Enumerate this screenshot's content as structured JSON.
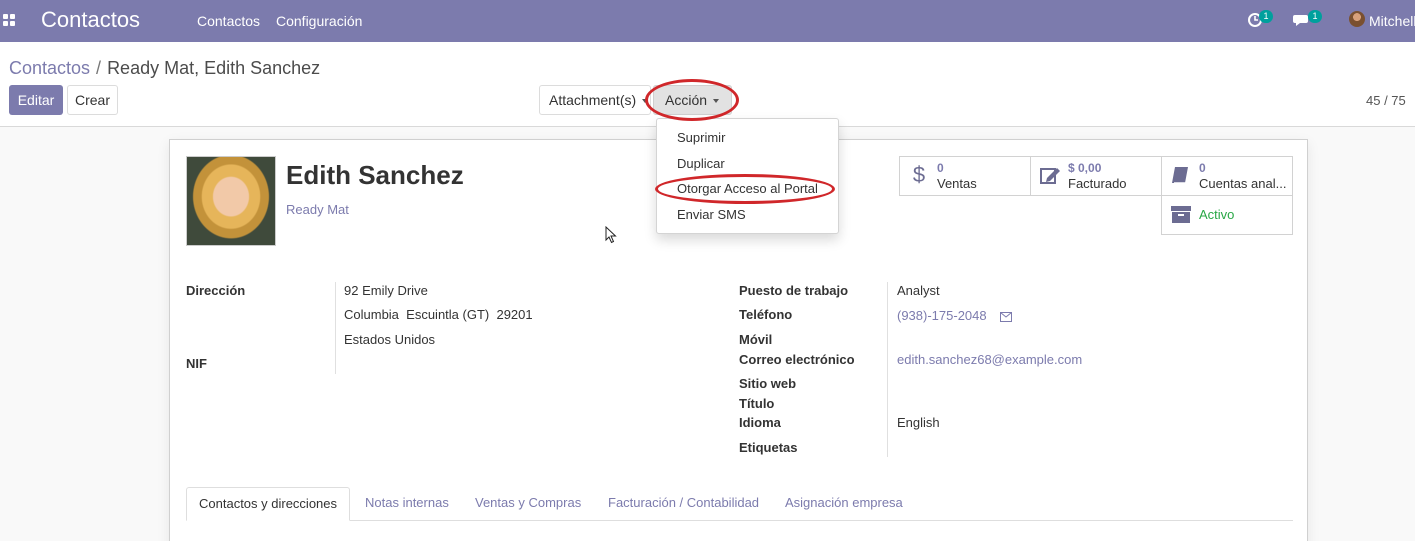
{
  "navbar": {
    "app_title": "Contactos",
    "menu": [
      "Contactos",
      "Configuración"
    ],
    "activity_count": "1",
    "messages_count": "1",
    "user_name": "Mitchell"
  },
  "breadcrumb": {
    "parent": "Contactos",
    "separator": "/",
    "current": "Ready Mat, Edith Sanchez"
  },
  "buttons": {
    "edit": "Editar",
    "create": "Crear",
    "attachments": "Attachment(s)",
    "action": "Acción"
  },
  "pager": "45 / 75",
  "action_menu": [
    "Suprimir",
    "Duplicar",
    "Otorgar Acceso al Portal",
    "Enviar SMS"
  ],
  "partner": {
    "name": "Edith Sanchez",
    "company": "Ready Mat"
  },
  "smart_buttons": {
    "ventas": {
      "value": "0",
      "label": "Ventas"
    },
    "facturado": {
      "value": "$ 0,00",
      "label": "Facturado"
    },
    "cuentas": {
      "value": "0",
      "label": "Cuentas anal..."
    },
    "activo": {
      "label": "Activo"
    }
  },
  "left_fields": {
    "address_label": "Dirección",
    "street": "92 Emily Drive",
    "city": "Columbia",
    "state": "Escuintla (GT)",
    "zip": "29201",
    "country": "Estados Unidos",
    "vat_label": "NIF"
  },
  "right_fields": {
    "job_label": "Puesto de trabajo",
    "job_value": "Analyst",
    "phone_label": "Teléfono",
    "phone_value": "(938)-175-2048",
    "mobile_label": "Móvil",
    "email_label": "Correo electrónico",
    "email_value": "edith.sanchez68@example.com",
    "website_label": "Sitio web",
    "title_label": "Título",
    "lang_label": "Idioma",
    "lang_value": "English",
    "tags_label": "Etiquetas"
  },
  "tabs": [
    "Contactos y direcciones",
    "Notas internas",
    "Ventas y Compras",
    "Facturación / Contabilidad",
    "Asignación empresa"
  ],
  "colors": {
    "brand": "#7c7bad",
    "annotation": "#d0272a",
    "active_status": "#28a745"
  }
}
